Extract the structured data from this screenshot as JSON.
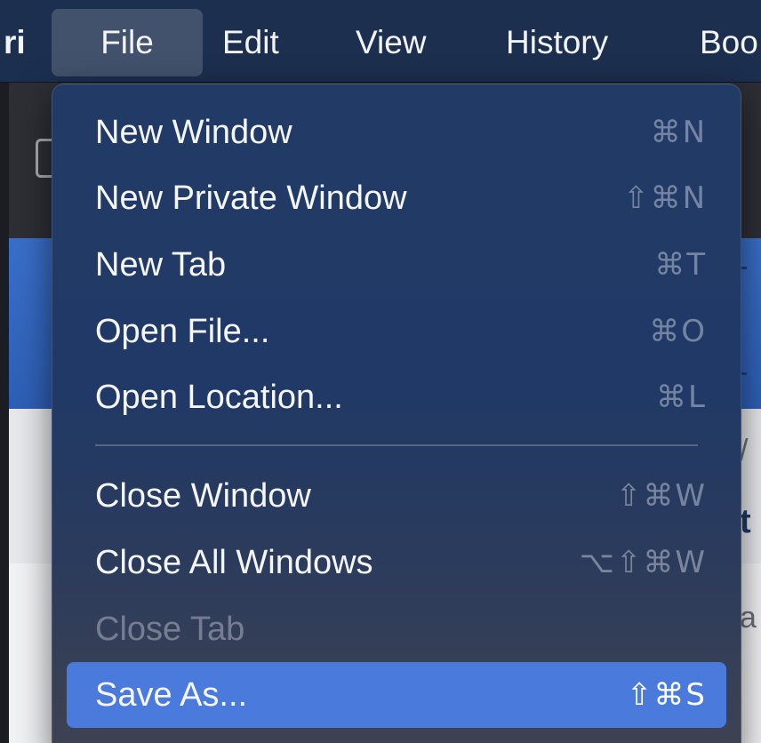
{
  "menubar": {
    "app_label": "ri",
    "file_label": "File",
    "edit_label": "Edit",
    "view_label": "View",
    "history_label": "History",
    "bookmarks_label": "Boo"
  },
  "file_menu": {
    "items": [
      {
        "label": "New Window",
        "shortcut": "⌘N",
        "enabled": true,
        "highlighted": false
      },
      {
        "label": "New Private Window",
        "shortcut": "⇧⌘N",
        "enabled": true,
        "highlighted": false
      },
      {
        "label": "New Tab",
        "shortcut": "⌘T",
        "enabled": true,
        "highlighted": false
      },
      {
        "label": "Open File...",
        "shortcut": "⌘O",
        "enabled": true,
        "highlighted": false
      },
      {
        "label": "Open Location...",
        "shortcut": "⌘L",
        "enabled": true,
        "highlighted": false
      },
      {
        "label": "Close Window",
        "shortcut": "⇧⌘W",
        "enabled": true,
        "highlighted": false
      },
      {
        "label": "Close All Windows",
        "shortcut": "⌥⇧⌘W",
        "enabled": true,
        "highlighted": false
      },
      {
        "label": "Close Tab",
        "shortcut": "",
        "enabled": false,
        "highlighted": false
      },
      {
        "label": "Save As...",
        "shortcut": "⇧⌘S",
        "enabled": true,
        "highlighted": true
      }
    ]
  },
  "background": {
    "fragment_1": "/",
    "fragment_2": "t",
    "fragment_3": "a"
  },
  "colors": {
    "menubar_bg": "#1c2f4f",
    "menu_bg_top": "#223a66",
    "highlight": "#4a7bdc",
    "page_banner": "#3a6fc9"
  }
}
